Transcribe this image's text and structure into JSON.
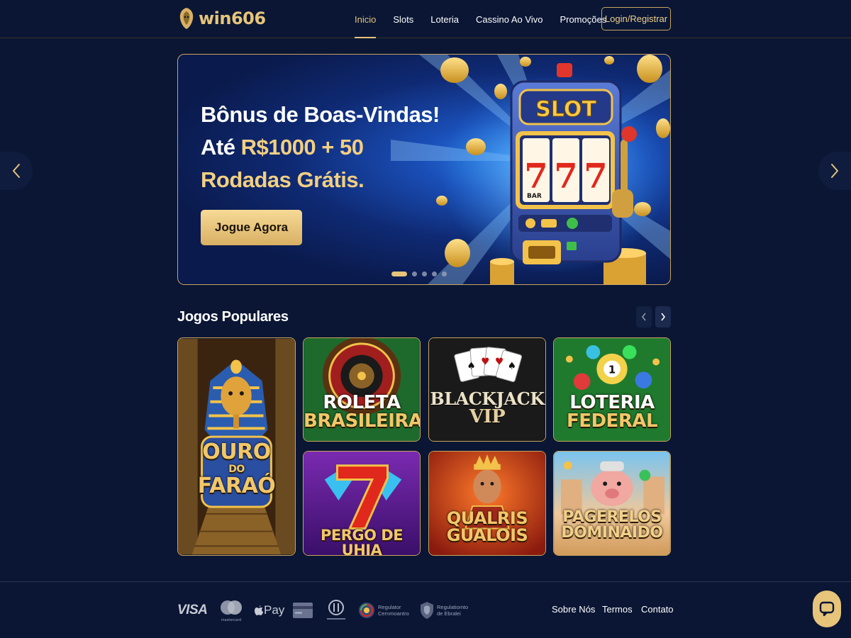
{
  "header": {
    "logo_text": "win606",
    "nav": [
      {
        "label": "Inicio",
        "active": true
      },
      {
        "label": "Slots",
        "active": false
      },
      {
        "label": "Loteria",
        "active": false
      },
      {
        "label": "Cassino Ao Vivo",
        "active": false
      },
      {
        "label": "Promoções",
        "active": false
      }
    ],
    "login_label": "Login/Registrar"
  },
  "carousel": {
    "prev_icon": "chevron-left-icon",
    "next_icon": "chevron-right-icon",
    "hero": {
      "title_line1": "Bônus de Boas-Vindas!",
      "title_line2_white": "Até ",
      "title_line2_gold": "R$1000 + 50",
      "title_line3": "Rodadas Grátis.",
      "cta_label": "Jogue Agora",
      "slot_sign": "SLOT",
      "reel_symbols": [
        "7",
        "7",
        "7"
      ],
      "bar_label": "BAR",
      "slide_count": 5,
      "active_slide": 1
    }
  },
  "popular": {
    "title": "Jogos Populares",
    "games": [
      {
        "line1": "OURO",
        "line2": "DO",
        "line3": "FARAÓ"
      },
      {
        "line1": "ROLETA",
        "line2": "BRASILEIRA"
      },
      {
        "line1": "BLACKJACK",
        "line2": "VIP"
      },
      {
        "line1": "LOTERIA",
        "line2": "FEDERAL"
      },
      {
        "line1": "PERGO DE UHIA"
      },
      {
        "line1": "QUALRIS",
        "line2": "GUALOIS"
      },
      {
        "line1": "PAGERELOS",
        "line2": "DOMINAIDO"
      }
    ]
  },
  "footer": {
    "payments": {
      "visa": "VISA",
      "mastercard_caption": "mastercard",
      "applepay": "Pay"
    },
    "regulator1": [
      "Regulator",
      "Cernmoantro"
    ],
    "regulator2": [
      "Regulatiomto",
      "de Ebralei"
    ],
    "links": [
      "Sobre Nós",
      "Termos",
      "Contato"
    ],
    "chat_icon": "chat-bubble-icon"
  },
  "colors": {
    "background": "#0a1634",
    "gold": "#e6c47a",
    "gold_border": "#c9a45e"
  }
}
